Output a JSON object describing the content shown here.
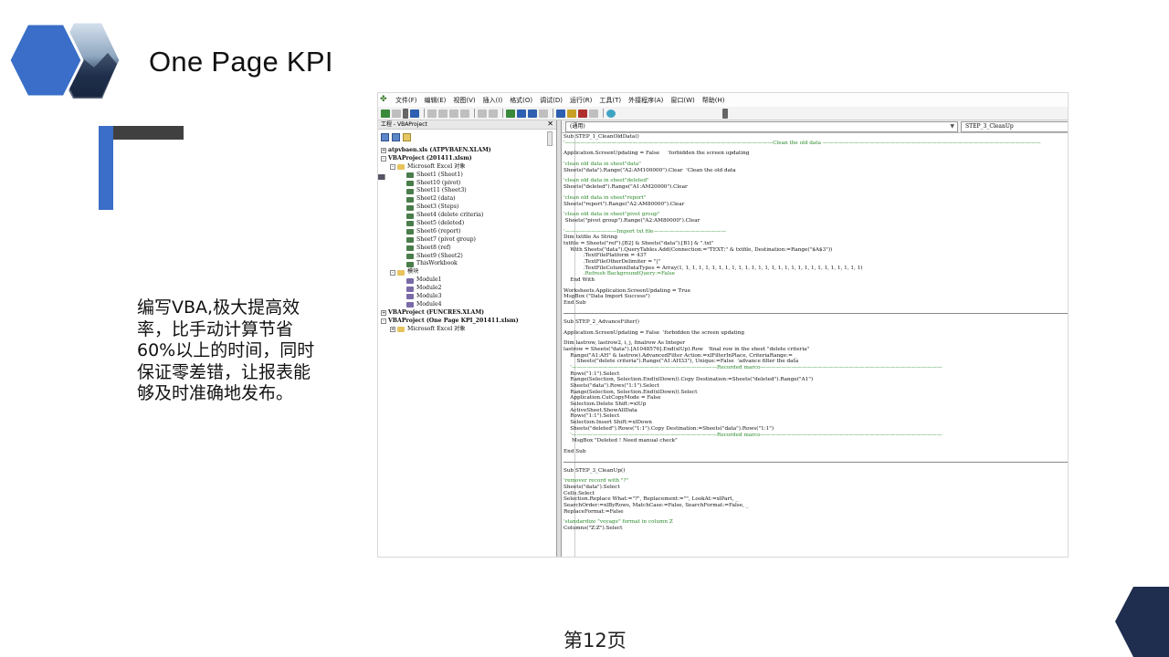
{
  "slide": {
    "title": "One Page KPI",
    "description": "编写VBA,极大提高效率，比手动计算节省60%以上的时间，同时保证零差错，让报表能够及时准确地发布。",
    "page_number": "第12页",
    "colors": {
      "accent_blue": "#3a6ec8",
      "dark_gray": "#404040",
      "navy": "#1f2d4e"
    }
  },
  "vbe": {
    "menu": [
      "文件(F)",
      "编辑(E)",
      "视图(V)",
      "插入(I)",
      "格式(O)",
      "调试(D)",
      "运行(R)",
      "工具(T)",
      "外接程序(A)",
      "窗口(W)",
      "帮助(H)"
    ],
    "project_pane": {
      "title": "工程 - VBAProject",
      "close_icon": "close-icon",
      "nodes": [
        {
          "level": 0,
          "toggle": "+",
          "icon": "proj",
          "label": "atpvbaen.xls (ATPVBAEN.XLAM)",
          "bold": true
        },
        {
          "level": 0,
          "toggle": "-",
          "icon": "proj",
          "label": "VBAProject (201411.xlsm)",
          "bold": true
        },
        {
          "level": 1,
          "toggle": "-",
          "icon": "fold",
          "label": "Microsoft Excel 对象",
          "bold": false
        },
        {
          "level": 2,
          "toggle": "",
          "icon": "sheet",
          "label": "Sheet1 (Sheet1)",
          "bold": false
        },
        {
          "level": 2,
          "toggle": "",
          "icon": "sheet",
          "label": "Sheet10 (pivot)",
          "bold": false
        },
        {
          "level": 2,
          "toggle": "",
          "icon": "sheet",
          "label": "Sheet11 (Sheet3)",
          "bold": false
        },
        {
          "level": 2,
          "toggle": "",
          "icon": "sheet",
          "label": "Sheet2 (data)",
          "bold": false
        },
        {
          "level": 2,
          "toggle": "",
          "icon": "sheet",
          "label": "Sheet3 (Steps)",
          "bold": false
        },
        {
          "level": 2,
          "toggle": "",
          "icon": "sheet",
          "label": "Sheet4 (delete criteria)",
          "bold": false
        },
        {
          "level": 2,
          "toggle": "",
          "icon": "sheet",
          "label": "Sheet5 (deleted)",
          "bold": false
        },
        {
          "level": 2,
          "toggle": "",
          "icon": "sheet",
          "label": "Sheet6 (report)",
          "bold": false
        },
        {
          "level": 2,
          "toggle": "",
          "icon": "sheet",
          "label": "Sheet7 (pivot group)",
          "bold": false
        },
        {
          "level": 2,
          "toggle": "",
          "icon": "sheet",
          "label": "Sheet8 (ref)",
          "bold": false
        },
        {
          "level": 2,
          "toggle": "",
          "icon": "sheet",
          "label": "Sheet9 (Sheet2)",
          "bold": false
        },
        {
          "level": 2,
          "toggle": "",
          "icon": "sheet",
          "label": "ThisWorkbook",
          "bold": false
        },
        {
          "level": 1,
          "toggle": "-",
          "icon": "fold",
          "label": "模块",
          "bold": false
        },
        {
          "level": 2,
          "toggle": "",
          "icon": "mod",
          "label": "Module1",
          "bold": false
        },
        {
          "level": 2,
          "toggle": "",
          "icon": "mod",
          "label": "Module2",
          "bold": false
        },
        {
          "level": 2,
          "toggle": "",
          "icon": "mod",
          "label": "Module3",
          "bold": false
        },
        {
          "level": 2,
          "toggle": "",
          "icon": "mod",
          "label": "Module4",
          "bold": false
        },
        {
          "level": 0,
          "toggle": "+",
          "icon": "proj",
          "label": "VBAProject (FUNCRES.XLAM)",
          "bold": true
        },
        {
          "level": 0,
          "toggle": "-",
          "icon": "proj",
          "label": "VBAProject (One Page KPI_201411.xlsm)",
          "bold": true
        },
        {
          "level": 1,
          "toggle": "+",
          "icon": "fold",
          "label": "Microsoft Excel 对象",
          "bold": false
        }
      ]
    },
    "code_pane": {
      "object_combo": "(通用)",
      "proc_combo": "STEP_3_CleanUp",
      "lines": [
        {
          "t": "Sub STEP_1_CleanOldData()",
          "k": "code"
        },
        {
          "t": "'————————————————————————————————————————Clean the old data ——————————————————————————————————————————",
          "k": "cm"
        },
        {
          "t": "",
          "k": "gap"
        },
        {
          "t": "Application.ScreenUpdating = False     'forbidden the screen updating",
          "k": "code"
        },
        {
          "t": "",
          "k": "gap"
        },
        {
          "t": "'clean old data in sheet\"data\"",
          "k": "cm"
        },
        {
          "t": "Sheets(\"data\").Range(\"A2:AM100000\").Clear  'Clean the old data",
          "k": "code"
        },
        {
          "t": "",
          "k": "gap"
        },
        {
          "t": "'clean old data in sheet\"deleted\"",
          "k": "cm"
        },
        {
          "t": "Sheets(\"deleted\").Range(\"A1:AM20000\").Clear",
          "k": "code"
        },
        {
          "t": "",
          "k": "gap"
        },
        {
          "t": "'clean old data in sheet\"report\"",
          "k": "cm"
        },
        {
          "t": "Sheets(\"report\").Range(\"A2:AM80000\").Clear",
          "k": "code"
        },
        {
          "t": "",
          "k": "gap"
        },
        {
          "t": "'clean old data in sheet\"pivot group\"",
          "k": "cm"
        },
        {
          "t": " Sheets(\"pivot group\").Range(\"A2:AM80000\").Clear",
          "k": "code"
        },
        {
          "t": "",
          "k": "gap"
        },
        {
          "t": "'——————————Import txt file——————————————",
          "k": "cm"
        },
        {
          "t": "Dim txtfile As String",
          "k": "code"
        },
        {
          "t": "txtfile = Sheets(\"ref\").[B2] & Sheets(\"data\").[B1] & \".txt\"",
          "k": "code"
        },
        {
          "t": "    With Sheets(\"data\").QueryTables.Add(Connection:=\"TEXT;\" & txtfile, Destination:=Range(\"$A$3\"))",
          "k": "code"
        },
        {
          "t": "            .TextFilePlatform = 437",
          "k": "code"
        },
        {
          "t": "            .TextFileOtherDelimiter = \"|\"",
          "k": "code"
        },
        {
          "t": "            .TextFileColumnDataTypes = Array(1, 1, 1, 1, 1, 1, 1, 1, 1, 1, 1, 1, 1, 1, 1, 1, 1, 1, 1, 1, 1, 1, 1, 1, 1, 1, 1, 1)",
          "k": "code"
        },
        {
          "t": "            .Refresh BackgroundQuery:=False",
          "k": "cm"
        },
        {
          "t": "    End With",
          "k": "code"
        },
        {
          "t": "",
          "k": "gap"
        },
        {
          "t": "Worksheets.Application.ScreenUpdating = True",
          "k": "code"
        },
        {
          "t": "MsgBox (\"Data Import Success\")",
          "k": "code"
        },
        {
          "t": "End Sub",
          "k": "code"
        },
        {
          "t": "",
          "k": "sep"
        },
        {
          "t": "Sub STEP_2_AdvanceFilter()",
          "k": "code"
        },
        {
          "t": "",
          "k": "gap"
        },
        {
          "t": "Application.ScreenUpdating = False  'forbidden the screen updating",
          "k": "code"
        },
        {
          "t": "",
          "k": "gap"
        },
        {
          "t": "Dim lastrow, lastrow2, i, j, finalrow As Integer",
          "k": "code"
        },
        {
          "t": "lastrow = Sheets(\"data\").[A1048576].End(xlUp).Row   'final row in the sheet \"delete criteria\"",
          "k": "code"
        },
        {
          "t": "    Range(\"A1:AH\" & lastrow).AdvancedFilter Action:=xlFilterInPlace, CriteriaRange:= _",
          "k": "code"
        },
        {
          "t": "        Sheets(\"delete criteria\").Range(\"A1:AH33\"), Unique:=False  'advance filter the data",
          "k": "code"
        },
        {
          "t": "    '————————————————————————————Recorded marco———————————————————————————————————",
          "k": "cm"
        },
        {
          "t": "    Rows(\"1:1\").Select",
          "k": "code"
        },
        {
          "t": "    Range(Selection, Selection.End(xlDown)).Copy Destination:=Sheets(\"deleted\").Range(\"A1\")",
          "k": "code"
        },
        {
          "t": "    Sheets(\"data\").Rows(\"1:1\").Select",
          "k": "code"
        },
        {
          "t": "    Range(Selection, Selection.End(xlDown)).Select",
          "k": "code"
        },
        {
          "t": "    Application.CutCopyMode = False",
          "k": "code"
        },
        {
          "t": "    Selection.Delete Shift:=xlUp",
          "k": "code"
        },
        {
          "t": "    ActiveSheet.ShowAllData",
          "k": "code"
        },
        {
          "t": "    Rows(\"1:1\").Select",
          "k": "code"
        },
        {
          "t": "    Selection.Insert Shift:=xlDown",
          "k": "code"
        },
        {
          "t": "    Sheets(\"deleted\").Rows(\"1:1\").Copy Destination:=Sheets(\"data\").Rows(\"1:1\")",
          "k": "code"
        },
        {
          "t": "    '————————————————————————————Recorded marco———————————————————————————————————",
          "k": "cm"
        },
        {
          "t": "     MsgBox \"Deleted ! Need manual check\"",
          "k": "code"
        },
        {
          "t": "",
          "k": "gap"
        },
        {
          "t": "End Sub",
          "k": "code"
        },
        {
          "t": "",
          "k": "sep"
        },
        {
          "t": "Sub STEP_3_CleanUp()",
          "k": "code"
        },
        {
          "t": "",
          "k": "gap"
        },
        {
          "t": "'remover record with \"?\"",
          "k": "cm"
        },
        {
          "t": "Sheets(\"data\").Select",
          "k": "code"
        },
        {
          "t": "Cells.Select",
          "k": "code"
        },
        {
          "t": "Selection.Replace What:=\"?\", Replacement:=\"\", LookAt:=xlPart, _",
          "k": "code"
        },
        {
          "t": "SearchOrder:=xlByRows, MatchCase:=False, SearchFormat:=False, _",
          "k": "code"
        },
        {
          "t": "ReplaceFormat:=False",
          "k": "code"
        },
        {
          "t": "",
          "k": "gap"
        },
        {
          "t": "'standardize \"voyage\" format in column Z",
          "k": "cm"
        },
        {
          "t": "Columns(\"Z:Z\").Select",
          "k": "code"
        }
      ]
    }
  }
}
